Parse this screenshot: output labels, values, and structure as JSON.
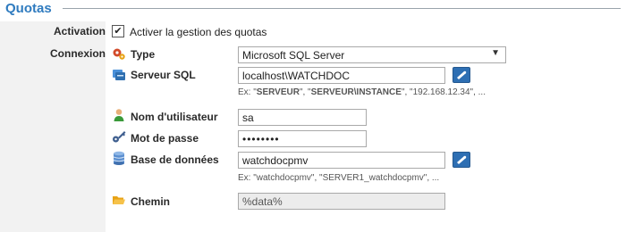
{
  "section": {
    "title": "Quotas"
  },
  "rows": {
    "activation": {
      "label": "Activation",
      "checkbox_checked": true,
      "checkbox_mark": "✔",
      "checkbox_label": "Activer la gestion des quotas"
    },
    "connexion": {
      "label": "Connexion"
    }
  },
  "fields": {
    "type": {
      "label": "Type",
      "value": "Microsoft SQL Server",
      "icon": "gears-icon"
    },
    "server": {
      "label": "Serveur SQL",
      "value": "localhost\\WATCHDOC",
      "icon": "server-icon",
      "hint_prefix": "Ex: \"",
      "hint_a": "SERVEUR",
      "hint_mid1": "\", \"",
      "hint_b": "SERVEUR\\INSTANCE",
      "hint_mid2": "\", \"192.168.12.34\", ..."
    },
    "username": {
      "label": "Nom d'utilisateur",
      "value": "sa",
      "icon": "user-icon"
    },
    "password": {
      "label": "Mot de passe",
      "value": "password",
      "icon": "key-icon"
    },
    "database": {
      "label": "Base de données",
      "value": "watchdocpmv",
      "icon": "database-icon",
      "hint": "Ex: \"watchdocpmv\", \"SERVER1_watchdocpmv\", ..."
    },
    "path": {
      "label": "Chemin",
      "value": "%data%",
      "icon": "folder-icon"
    }
  },
  "colors": {
    "title": "#2f7bbf",
    "button": "#2e6fb3"
  }
}
